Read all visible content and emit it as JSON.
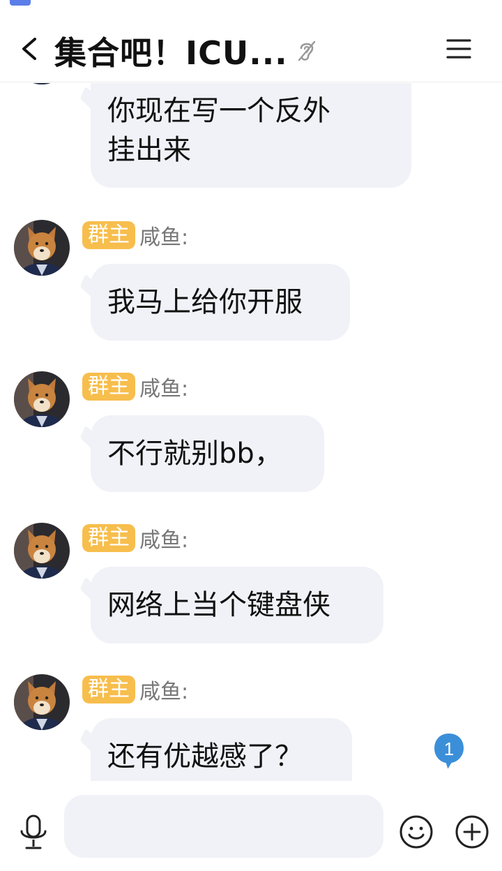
{
  "header": {
    "title": "集合吧！ICU...",
    "back_icon": "chevron-left-icon",
    "ear_icon": "ear-icon",
    "menu_icon": "hamburger-menu-icon"
  },
  "messages": [
    {
      "text": "你现在写一个反外\n挂出来",
      "role": "",
      "sender": ""
    },
    {
      "role": "群主",
      "sender": "咸鱼:",
      "text": "我马上给你开服"
    },
    {
      "role": "群主",
      "sender": "咸鱼:",
      "text": "不行就别bb，"
    },
    {
      "role": "群主",
      "sender": "咸鱼:",
      "text": "网络上当个键盘侠"
    },
    {
      "role": "群主",
      "sender": "咸鱼:",
      "text": "还有优越感了？"
    }
  ],
  "unread_count": "1",
  "input_bar": {
    "voice_icon": "microphone-icon",
    "emoji_icon": "smiley-icon",
    "plus_icon": "plus-circle-icon"
  },
  "colors": {
    "badge": "#f7be4d",
    "bubble": "#f1f2f7",
    "unread": "#3b8fd8"
  }
}
